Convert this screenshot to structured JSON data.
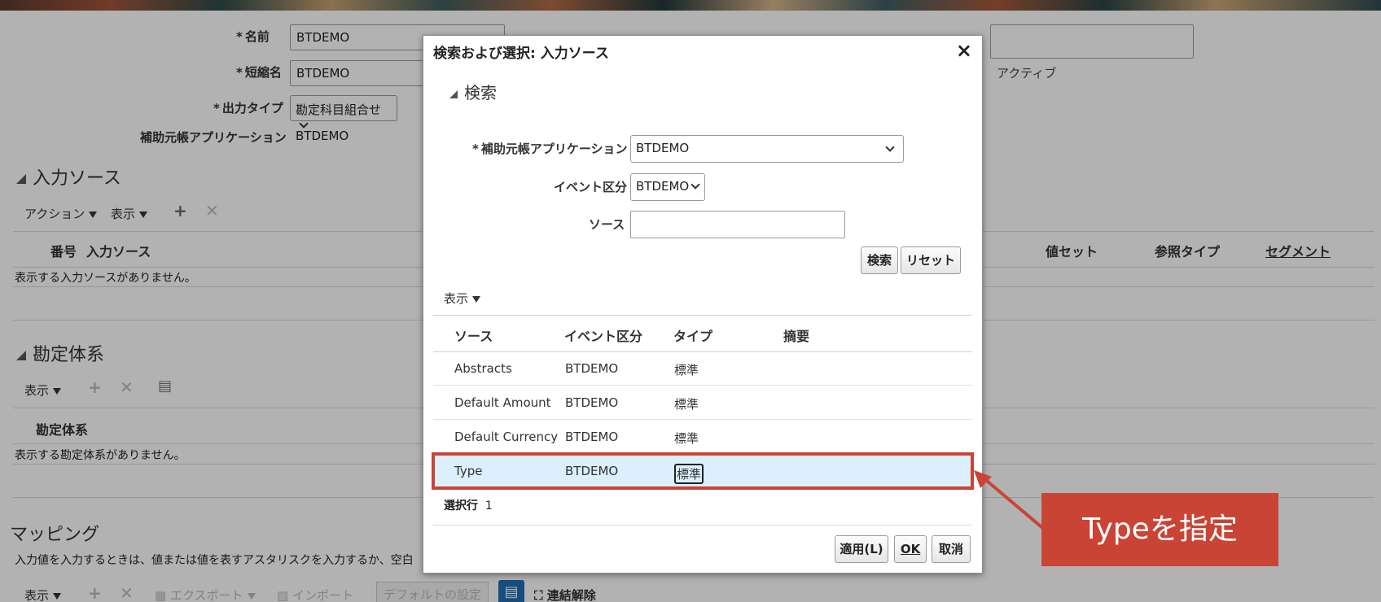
{
  "header": {
    "name_label": "名前",
    "name_value": "BTDEMO",
    "short_name_label": "短縮名",
    "short_name_value": "BTDEMO",
    "output_type_label": "出力タイプ",
    "output_type_value": "勘定科目組合せ",
    "subledger_app_label": "補助元帳アプリケーション",
    "subledger_app_value": "BTDEMO",
    "active_label": "アクティブ",
    "required_mark": "*"
  },
  "input_source_section": {
    "title": "入力ソース",
    "actions_label": "アクション",
    "view_label": "表示",
    "columns": [
      "番号",
      "入力ソース",
      "値セット",
      "参照タイプ",
      "セグメント"
    ],
    "empty_text": "表示する入力ソースがありません。"
  },
  "chart_of_accounts_section": {
    "title": "勘定体系",
    "view_label": "表示",
    "column": "勘定体系",
    "empty_text": "表示する勘定体系がありません。"
  },
  "mapping_section": {
    "title": "マッピング",
    "hint": "入力値を入力するときは、値または値を表すアスタリスクを入力するか、空白",
    "view_label": "表示",
    "export_label": "エクスポート",
    "import_label": "インポート",
    "default_setting_label": "デフォルトの設定",
    "unlink_label": "連結解除"
  },
  "dialog": {
    "title": "検索および選択: 入力ソース",
    "close": "×",
    "search_section_title": "検索",
    "subledger_app_label": "補助元帳アプリケーション",
    "subledger_app_value": "BTDEMO",
    "event_class_label": "イベント区分",
    "event_class_value": "BTDEMO",
    "source_label": "ソース",
    "source_value": "",
    "search_button": "検索",
    "reset_button": "リセット",
    "view_label": "表示",
    "columns": [
      "ソース",
      "イベント区分",
      "タイプ",
      "摘要"
    ],
    "rows": [
      {
        "source": "Abstracts",
        "event_class": "BTDEMO",
        "type": "標準"
      },
      {
        "source": "Default Amount",
        "event_class": "BTDEMO",
        "type": "標準"
      },
      {
        "source": "Default Currency",
        "event_class": "BTDEMO",
        "type": "標準"
      },
      {
        "source": "Type",
        "event_class": "BTDEMO",
        "type": "標準"
      }
    ],
    "selected_rows_label": "選択行",
    "selected_rows_count": "1",
    "apply_button": "適用(L)",
    "ok_button": "OK",
    "cancel_button": "取消"
  },
  "annotation": {
    "callout_text": "Typeを指定",
    "color": "#c94435"
  }
}
